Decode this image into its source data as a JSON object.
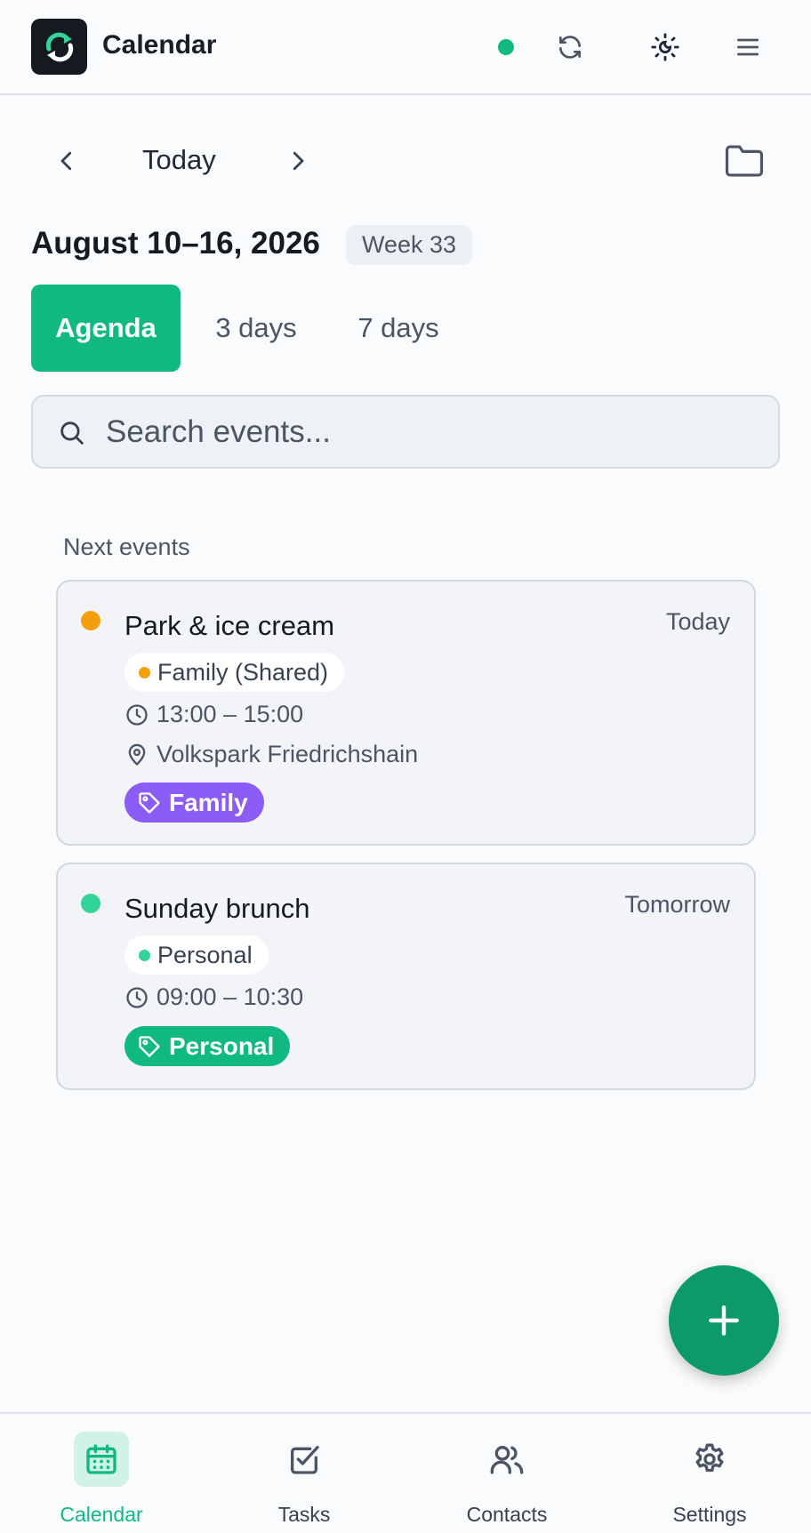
{
  "app": {
    "title": "Calendar",
    "sync_status_color": "#12b981",
    "header_icons": [
      "sync-icon",
      "theme-icon",
      "menu-icon"
    ]
  },
  "navigation": {
    "today_label": "Today",
    "range_title": "August 10–16, 2026",
    "week_badge": "Week 33"
  },
  "view_tabs": [
    {
      "label": "Agenda",
      "active": true
    },
    {
      "label": "3 days",
      "active": false
    },
    {
      "label": "7 days",
      "active": false
    }
  ],
  "search": {
    "placeholder": "Search events..."
  },
  "agenda": {
    "section_label": "Next events",
    "events": [
      {
        "title": "Park & ice cream",
        "when": "Today",
        "color": "#f59e0b",
        "calendar": "Family (Shared)",
        "time": "13:00 – 15:00",
        "location": "Volkspark Friedrichshain",
        "tag": "Family",
        "tag_color": "#8b5cf6"
      },
      {
        "title": "Sunday brunch",
        "when": "Tomorrow",
        "color": "#34d399",
        "calendar": "Personal",
        "time": "09:00 – 10:30",
        "tag": "Personal",
        "tag_color": "#10b981"
      }
    ]
  },
  "bottom_nav": [
    {
      "label": "Calendar",
      "icon": "calendar-icon",
      "active": true
    },
    {
      "label": "Tasks",
      "icon": "checkbox-icon",
      "active": false
    },
    {
      "label": "Contacts",
      "icon": "users-icon",
      "active": false
    },
    {
      "label": "Settings",
      "icon": "gear-icon",
      "active": false
    }
  ],
  "colors": {
    "accent": "#10b981",
    "fab": "#0c9a6c"
  }
}
